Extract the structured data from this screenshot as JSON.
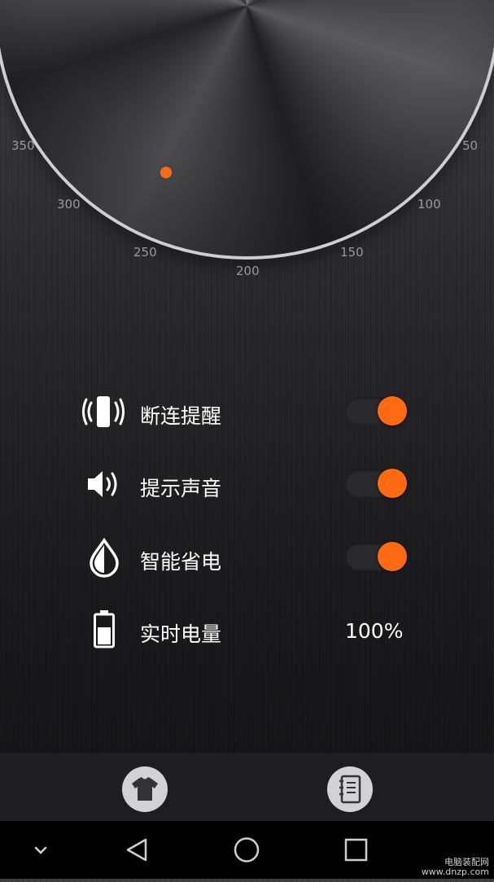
{
  "knob": {
    "indicator_color": "#ff6a13",
    "scale_labels": [
      "350",
      "50",
      "300",
      "100",
      "250",
      "150",
      "200"
    ]
  },
  "settings": [
    {
      "icon": "vibrate-phone-icon",
      "label": "断连提醒",
      "type": "toggle",
      "on": true
    },
    {
      "icon": "speaker-icon",
      "label": "提示声音",
      "type": "toggle",
      "on": true
    },
    {
      "icon": "water-drop-icon",
      "label": "智能省电",
      "type": "toggle",
      "on": true
    },
    {
      "icon": "battery-icon",
      "label": "实时电量",
      "type": "value",
      "value": "100%"
    }
  ],
  "bottom_bar": {
    "left_button_icon": "tshirt-icon",
    "right_button_icon": "notebook-icon"
  },
  "nav": {
    "items": [
      "chevron-down-icon",
      "back-triangle-icon",
      "home-circle-icon",
      "recents-square-icon"
    ]
  },
  "watermark": {
    "line1": "电脑装配网",
    "line2": "www.dnzp.com"
  },
  "colors": {
    "accent": "#ff6a13",
    "text": "#ffffff",
    "tick_text": "#9a9a9c"
  }
}
